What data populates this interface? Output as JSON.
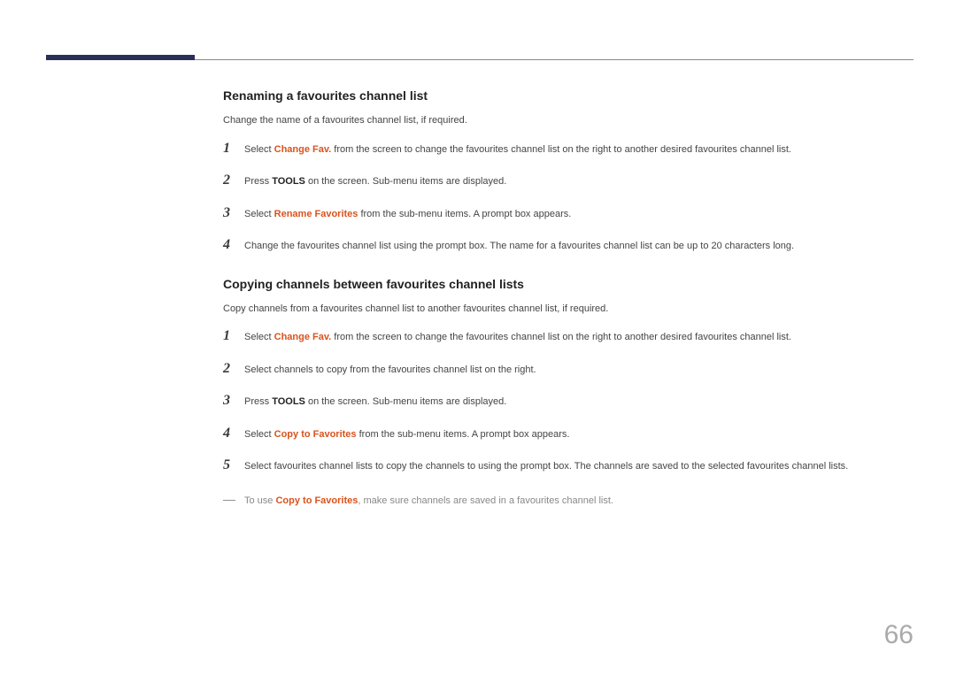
{
  "section1": {
    "heading": "Renaming a favourites channel list",
    "intro": "Change the name of a favourites channel list, if required.",
    "steps": [
      {
        "num": "1",
        "prefix": "Select ",
        "highlight": "Change Fav.",
        "suffix": " from the screen to change the favourites channel list on the right to another desired favourites channel list."
      },
      {
        "num": "2",
        "prefix": "Press ",
        "bold": "TOOLS",
        "suffix": " on the screen. Sub-menu items are displayed."
      },
      {
        "num": "3",
        "prefix": "Select ",
        "highlight": "Rename Favorites",
        "suffix": " from the sub-menu items. A prompt box appears."
      },
      {
        "num": "4",
        "text": "Change the favourites channel list using the prompt box. The name for a favourites channel list can be up to 20 characters long."
      }
    ]
  },
  "section2": {
    "heading": "Copying channels between favourites channel lists",
    "intro": "Copy channels from a favourites channel list to another favourites channel list, if required.",
    "steps": [
      {
        "num": "1",
        "prefix": "Select ",
        "highlight": "Change Fav.",
        "suffix": " from the screen to change the favourites channel list on the right to another desired favourites channel list."
      },
      {
        "num": "2",
        "text": "Select channels to copy from the favourites channel list on the right."
      },
      {
        "num": "3",
        "prefix": "Press ",
        "bold": "TOOLS",
        "suffix": " on the screen. Sub-menu items are displayed."
      },
      {
        "num": "4",
        "prefix": "Select ",
        "highlight": "Copy to Favorites",
        "suffix": " from the sub-menu items. A prompt box appears."
      },
      {
        "num": "5",
        "text": "Select favourites channel lists to copy the channels to using the prompt box. The channels are saved to the selected favourites channel lists."
      }
    ],
    "note": {
      "dash": "―",
      "prefix": "To use ",
      "highlight": "Copy to Favorites",
      "suffix": ", make sure channels are saved in a favourites channel list."
    }
  },
  "page_number": "66"
}
